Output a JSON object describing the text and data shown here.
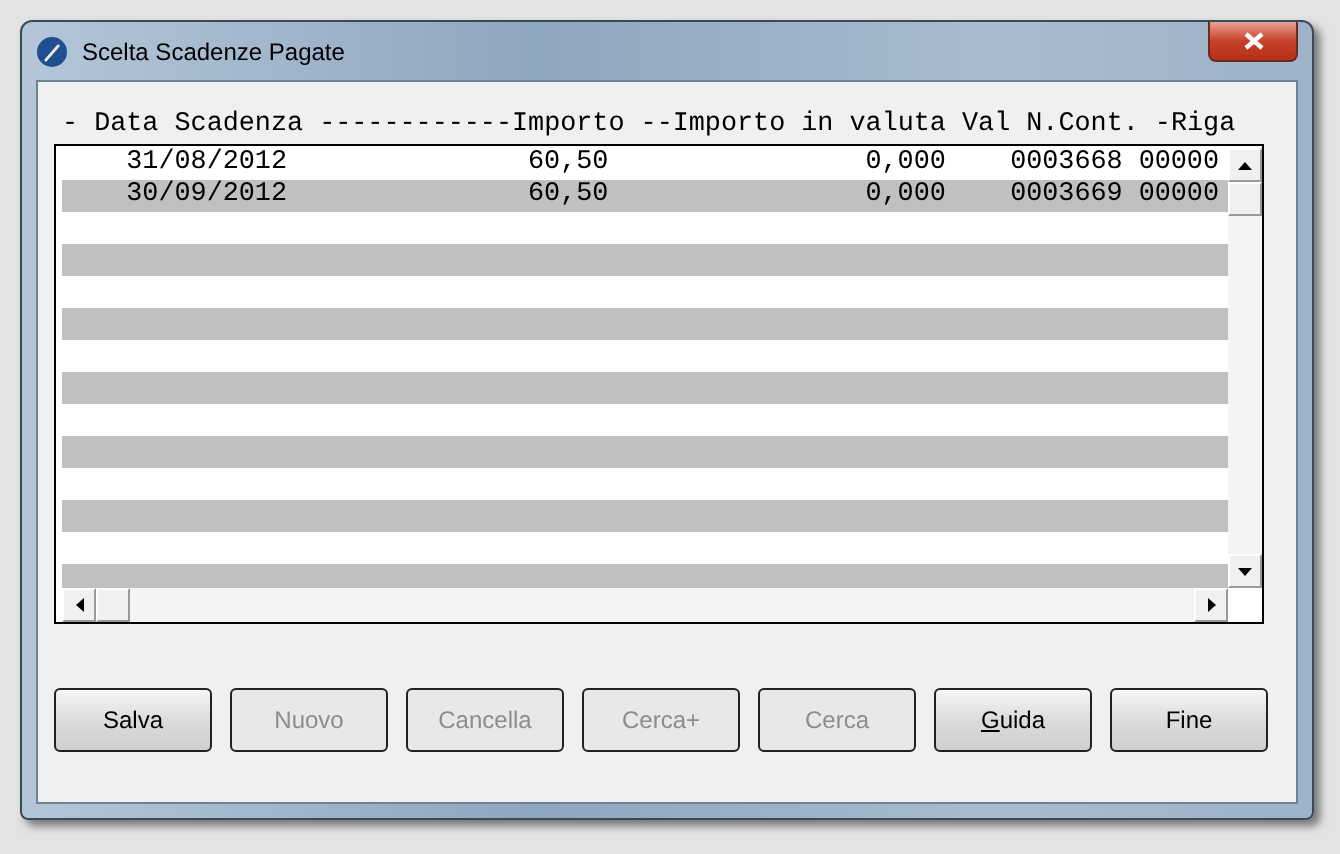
{
  "window": {
    "title": "Scelta Scadenze Pagate"
  },
  "list": {
    "header": "- Data Scadenza ------------Importo --Importo in valuta Val N.Cont. -Riga",
    "rows": [
      {
        "cells": [
          "31/08/2012",
          "60,50",
          "0,000",
          "0003668",
          "00000"
        ],
        "selected": false
      },
      {
        "cells": [
          "30/09/2012",
          "60,50",
          "0,000",
          "0003669",
          "00000"
        ],
        "selected": true
      }
    ]
  },
  "buttons": [
    {
      "label": "Salva",
      "disabled": false,
      "mnemonic": false
    },
    {
      "label": "Nuovo",
      "disabled": true,
      "mnemonic": false
    },
    {
      "label": "Cancella",
      "disabled": true,
      "mnemonic": false
    },
    {
      "label": "Cerca+",
      "disabled": true,
      "mnemonic": false
    },
    {
      "label": "Cerca",
      "disabled": true,
      "mnemonic": false
    },
    {
      "label": "Guida",
      "disabled": false,
      "mnemonic": true
    },
    {
      "label": "Fine",
      "disabled": false,
      "mnemonic": false
    }
  ]
}
